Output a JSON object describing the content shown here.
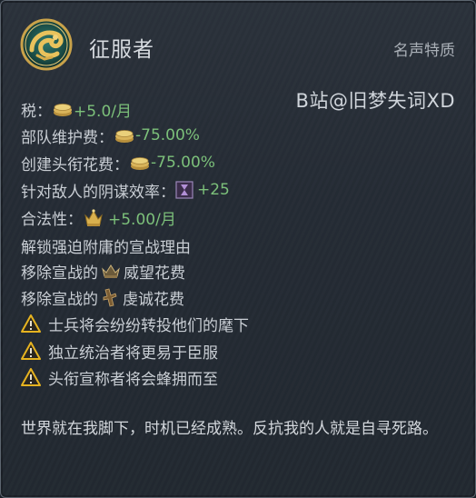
{
  "trait": {
    "name": "征服者",
    "category": "名声特质",
    "icon": "conqueror-trait-icon"
  },
  "watermark": "B站@旧梦失词XD",
  "modifiers": [
    {
      "label": "税：",
      "icon": "gold-coins-icon",
      "value": "+5.0/月"
    },
    {
      "label": "部队维护费：",
      "icon": "gold-coins-icon",
      "value": "-75.00%"
    },
    {
      "label": "创建头衔花费：",
      "icon": "gold-coins-icon",
      "value": "-75.00%"
    },
    {
      "label": "针对敌人的阴谋效率：",
      "icon": "intrigue-scheme-icon",
      "value": "+25"
    },
    {
      "label": "合法性：",
      "icon": "legitimacy-crown-icon",
      "value": "+5.00/月"
    }
  ],
  "unlocks": [
    {
      "text": "解锁强迫附庸的宣战理由"
    },
    {
      "text_before": "移除宣战的",
      "icon": "prestige-crown-icon",
      "text_after": "威望花费"
    },
    {
      "text_before": "移除宣战的",
      "icon": "piety-icon",
      "text_after": "虔诚花费"
    }
  ],
  "warnings": [
    {
      "icon": "warning-triangle-icon",
      "text": "士兵将会纷纷转投他们的麾下"
    },
    {
      "icon": "warning-triangle-icon",
      "text": "独立统治者将更易于臣服"
    },
    {
      "icon": "warning-triangle-icon",
      "text": "头衔宣称者将会蜂拥而至"
    }
  ],
  "flavor_text": "世界就在我脚下，时机已经成熟。反抗我的人就是自寻死路。",
  "colors": {
    "positive": "#7cc07a",
    "text": "#c9ced4",
    "warning": "#e6b320"
  }
}
